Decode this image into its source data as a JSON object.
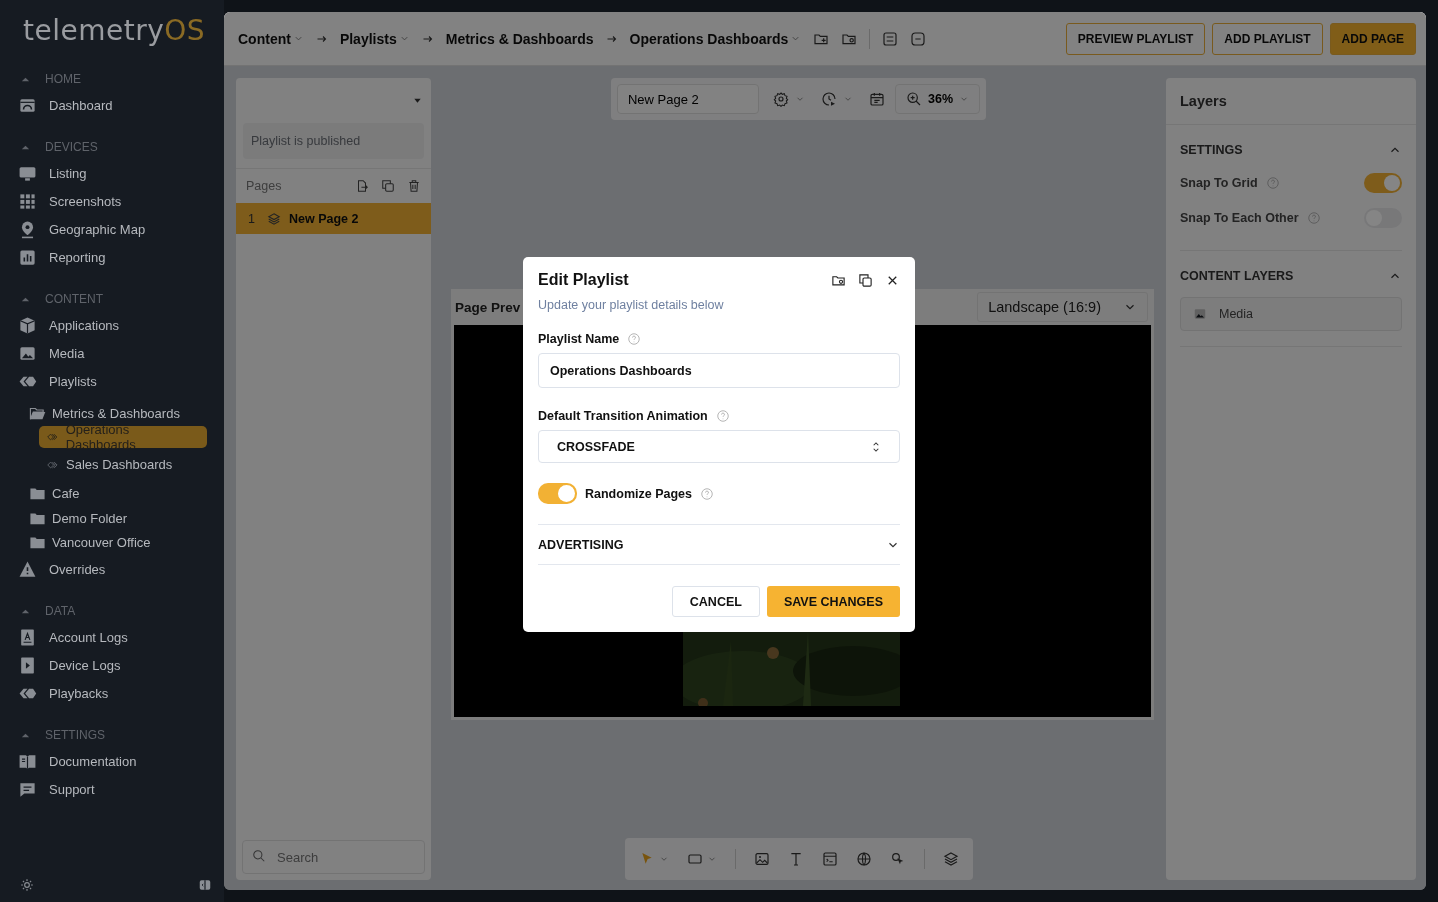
{
  "logo": {
    "text": "telemetry",
    "accent": "OS"
  },
  "sidebar": {
    "sections": [
      {
        "title": "HOME",
        "expanded": true,
        "items": [
          {
            "label": "Dashboard"
          }
        ]
      },
      {
        "title": "DEVICES",
        "expanded": true,
        "items": [
          {
            "label": "Listing"
          },
          {
            "label": "Screenshots"
          },
          {
            "label": "Geographic Map"
          },
          {
            "label": "Reporting"
          }
        ]
      },
      {
        "title": "CONTENT",
        "expanded": true,
        "items": [
          {
            "label": "Applications"
          },
          {
            "label": "Media"
          },
          {
            "label": "Playlists",
            "children": [
              {
                "label": "Metrics & Dashboards",
                "kind": "folder",
                "expanded": true,
                "children": [
                  {
                    "label": "Operations Dashboards",
                    "kind": "playlist",
                    "selected": true
                  },
                  {
                    "label": "Sales Dashboards",
                    "kind": "playlist",
                    "selected": false
                  }
                ]
              },
              {
                "label": "Cafe",
                "kind": "folder",
                "expanded": false
              },
              {
                "label": "Demo Folder",
                "kind": "folder",
                "expanded": false
              },
              {
                "label": "Vancouver Office",
                "kind": "folder",
                "expanded": false
              }
            ]
          },
          {
            "label": "Overrides"
          }
        ]
      },
      {
        "title": "DATA",
        "expanded": true,
        "items": [
          {
            "label": "Account Logs"
          },
          {
            "label": "Device Logs"
          },
          {
            "label": "Playbacks"
          }
        ]
      },
      {
        "title": "SETTINGS",
        "expanded": true,
        "items": [
          {
            "label": "Documentation"
          },
          {
            "label": "Support"
          }
        ]
      }
    ]
  },
  "breadcrumbs": [
    {
      "label": "Content",
      "dropdown": true
    },
    {
      "label": "Playlists",
      "dropdown": true
    },
    {
      "label": "Metrics & Dashboards",
      "dropdown": false
    },
    {
      "label": "Operations Dashboards",
      "dropdown": true
    }
  ],
  "top_buttons": [
    {
      "label": "PREVIEW PLAYLIST",
      "kind": "outline"
    },
    {
      "label": "ADD PLAYLIST",
      "kind": "outline"
    },
    {
      "label": "ADD PAGE",
      "kind": "primary"
    }
  ],
  "pages_panel": {
    "status": "Playlist is published",
    "title": "Pages",
    "pages": [
      {
        "number": "1",
        "name": "New Page 2",
        "selected": true
      }
    ],
    "search": {
      "placeholder": "Search"
    }
  },
  "canvas_toolbar": {
    "page_name": "New Page 2",
    "zoom": "36%"
  },
  "preview": {
    "title": "Page Prev",
    "orientation": "Landscape (16:9)"
  },
  "layers_panel": {
    "title": "Layers",
    "settings": {
      "title": "SETTINGS",
      "expanded": true,
      "toggles": [
        {
          "label": "Snap To Grid",
          "on": true
        },
        {
          "label": "Snap To Each Other",
          "on": false
        }
      ]
    },
    "content_layers": {
      "title": "CONTENT LAYERS",
      "expanded": true,
      "layers": [
        {
          "name": "Media"
        }
      ]
    }
  },
  "dialog": {
    "title": "Edit Playlist",
    "subtitle": "Update your playlist details below",
    "name_label": "Playlist Name",
    "name_value": "Operations Dashboards",
    "transition_label": "Default Transition Animation",
    "transition_value": "CROSSFADE",
    "randomize": {
      "label": "Randomize Pages",
      "on": true
    },
    "advertising": {
      "title": "ADVERTISING",
      "expanded": false
    },
    "buttons": [
      {
        "label": "CANCEL",
        "kind": "secondary"
      },
      {
        "label": "SAVE CHANGES",
        "kind": "primary"
      }
    ]
  }
}
